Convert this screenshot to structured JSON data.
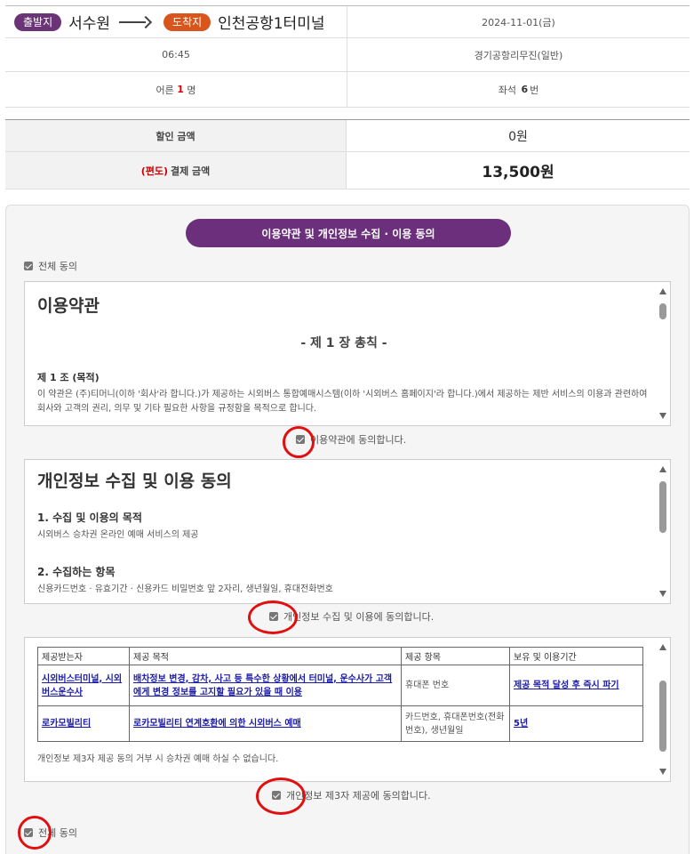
{
  "trip": {
    "departure_badge": "출발지",
    "departure": "서수원",
    "arrival_badge": "도착지",
    "arrival": "인천공항1터미널",
    "date": "2024-11-01(금)",
    "time": "06:45",
    "bus_company": "경기공항리무진(일반)",
    "passenger_label": "어른",
    "passenger_count": "1",
    "passenger_unit": "명",
    "seat_label": "좌석",
    "seat_number": "6",
    "seat_unit": "번"
  },
  "payment": {
    "discount_label": "할인 금액",
    "discount_value": "0원",
    "total_prefix": "(편도)",
    "total_label": "결제 금액",
    "total_value": "13,500원"
  },
  "agreement": {
    "title": "이용약관 및 개인정보 수집 · 이용 동의",
    "agree_all_top": "전체 동의",
    "terms": {
      "heading": "이용약관",
      "chapter": "- 제 1 장 총칙 -",
      "article": "제 1 조 (목적)",
      "body": "이 약관은 (주)티머니(이하 '회사'라 합니다.)가 제공하는 시외버스 통합예매시스템(이하 '시외버스 홈페이지'라 합니다.)에서 제공하는 제반 서비스의 이용과 관련하여 회사와 고객의 권리, 의무 및 기타 필요한 사항을 규정함을 목적으로 합니다.",
      "checkbox_label": "이용약관에 동의합니다."
    },
    "privacy": {
      "heading": "개인정보 수집 및 이용 동의",
      "section1_title": "1. 수집 및 이용의 목적",
      "section1_body": "시외버스 승차권 온라인 예매 서비스의 제공",
      "section2_title": "2. 수집하는 항목",
      "section2_body": "신용카드번호 · 유효기간 · 신용카드 비밀번호 앞 2자리, 생년월일, 휴대전화번호",
      "checkbox_label": "개인정보 수집 및 이용에 동의합니다."
    },
    "third_party": {
      "headers": [
        "제공받는자",
        "제공 목적",
        "제공 항목",
        "보유 및 이용기간"
      ],
      "rows": [
        {
          "recipient": "시외버스터미널, 시외버스운수사",
          "purpose": "배차정보 변경, 감차, 사고 등 특수한 상황에서 터미널, 운수사가 고객에게 변경 정보를 고지할 필요가 있을 때 이용",
          "items": "휴대폰 번호",
          "period": "제공 목적 달성 후 즉시 파기"
        },
        {
          "recipient": "로카모빌리티",
          "purpose": "로카모빌리티 연계호환에 의한 시외버스 예매",
          "items": "카드번호, 휴대폰번호(전화번호), 생년월일",
          "period": "5년"
        }
      ],
      "note": "개인정보 제3자 제공 동의 거부 시 승차권 예매 하실 수 없습니다.",
      "checkbox_label": "개인정보 제3자 제공에 동의합니다."
    },
    "agree_all_bottom": "전체 동의"
  }
}
